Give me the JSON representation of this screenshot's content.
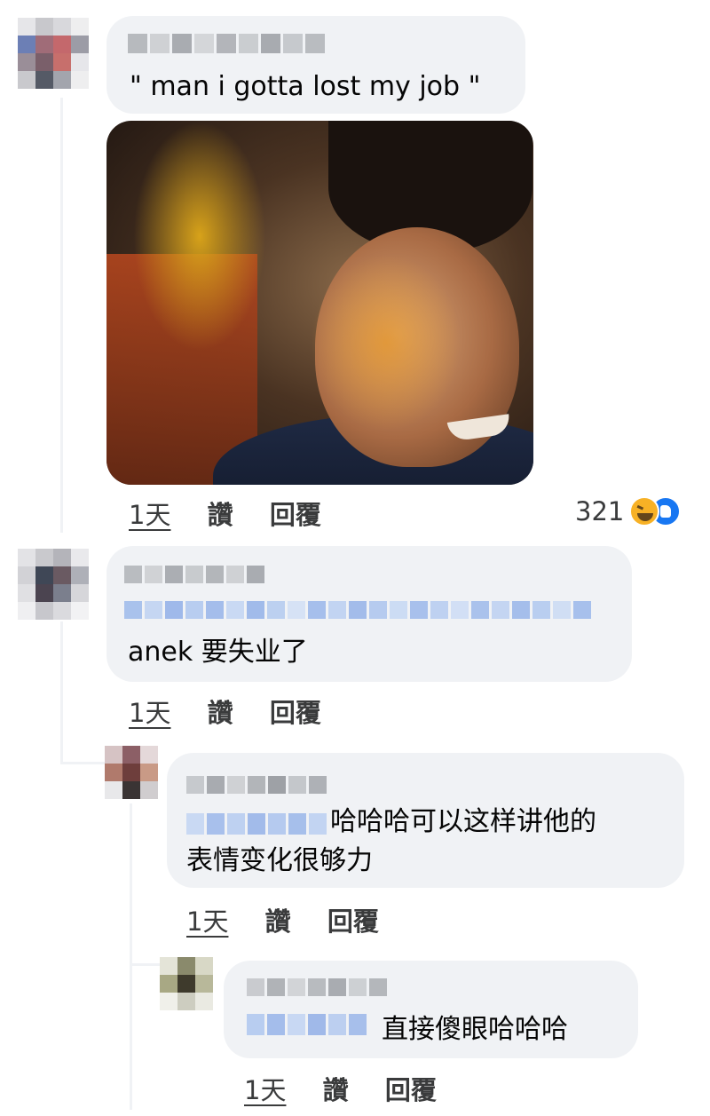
{
  "colors": {
    "bubble_bg": "#f0f2f5",
    "meta_text": "#3a3b3c",
    "redacted_name": "#b0b3b8",
    "redacted_tag": "#a8c3ee",
    "like_blue": "#1877f2",
    "haha_yellow": "#f7b125"
  },
  "comments": [
    {
      "text": "\" man i gotta lost my job \"",
      "has_photo": true,
      "meta": {
        "time": "1天",
        "like": "讚",
        "reply": "回覆"
      },
      "reactions": {
        "count": "321",
        "icons": [
          "haha-emoji-icon",
          "like-thumb-icon"
        ]
      }
    },
    {
      "text": "anek 要失业了",
      "meta": {
        "time": "1天",
        "like": "讚",
        "reply": "回覆"
      }
    },
    {
      "text_line1": "哈哈哈可以这样讲他的",
      "text_line2": "表情变化很够力",
      "meta": {
        "time": "1天",
        "like": "讚",
        "reply": "回覆"
      }
    },
    {
      "text": "直接傻眼哈哈哈",
      "meta": {
        "time": "1天",
        "like": "讚",
        "reply": "回覆"
      }
    }
  ]
}
